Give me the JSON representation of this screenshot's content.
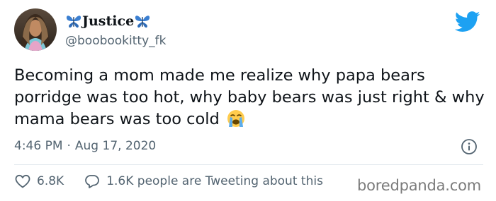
{
  "author": {
    "name": "Justice",
    "handle": "@boobookitty_fk",
    "name_emoji_left": "butterfly-icon",
    "name_emoji_right": "butterfly-icon"
  },
  "tweet": {
    "text": "Becoming a mom made me realize why papa bears porridge was too hot, why baby bears was just right & why mama bears was too cold",
    "emoji": "loudly-crying-face-icon"
  },
  "meta": {
    "time": "4:46 PM",
    "separator": "·",
    "date": "Aug 17, 2020"
  },
  "actions": {
    "likes": "6.8K",
    "conversation": "1.6K people are Tweeting about this"
  },
  "watermark": "boredpanda.com",
  "colors": {
    "twitter_blue": "#1da1f2",
    "secondary_text": "#536471",
    "butterfly_blue": "#3b7fd1"
  }
}
